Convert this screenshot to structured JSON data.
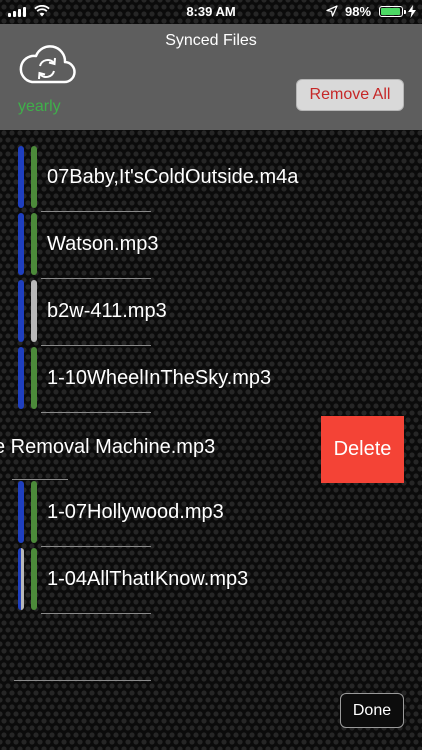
{
  "status_bar": {
    "time": "8:39 AM",
    "battery_percent": "98%",
    "battery_level": 0.98,
    "icons": [
      "signal-icon",
      "wifi-icon",
      "location-icon",
      "battery-icon",
      "charging-bolt-icon"
    ]
  },
  "header": {
    "title": "Synced Files",
    "plan": "yearly",
    "remove_all_label": "Remove All",
    "cloud_icon": "cloud-sync-icon"
  },
  "files": [
    {
      "name": "07Baby,It'sColdOutside.m4a",
      "left_color": "blue",
      "right_color": "green"
    },
    {
      "name": "Watson.mp3",
      "left_color": "blue",
      "right_color": "green"
    },
    {
      "name": "b2w-411.mp3",
      "left_color": "blue",
      "right_color": "grey"
    },
    {
      "name": "1-10WheelInTheSky.mp3",
      "left_color": "blue",
      "right_color": "green"
    },
    {
      "name": "e Removal Machine.mp3",
      "swiped": true,
      "delete_label": "Delete"
    },
    {
      "name": "1-07Hollywood.mp3",
      "left_color": "blue",
      "right_color": "green"
    },
    {
      "name": "1-04AllThatIKnow.mp3",
      "left_color": "blue-grey",
      "right_color": "green"
    }
  ],
  "colors": {
    "blue": "#1f3fbf",
    "green": "#4c8a3a",
    "grey": "#b8b8b8",
    "delete_red": "#f44336",
    "plan_green": "#3fb04a",
    "remove_all_text": "#c62828"
  },
  "footer": {
    "done_label": "Done"
  }
}
